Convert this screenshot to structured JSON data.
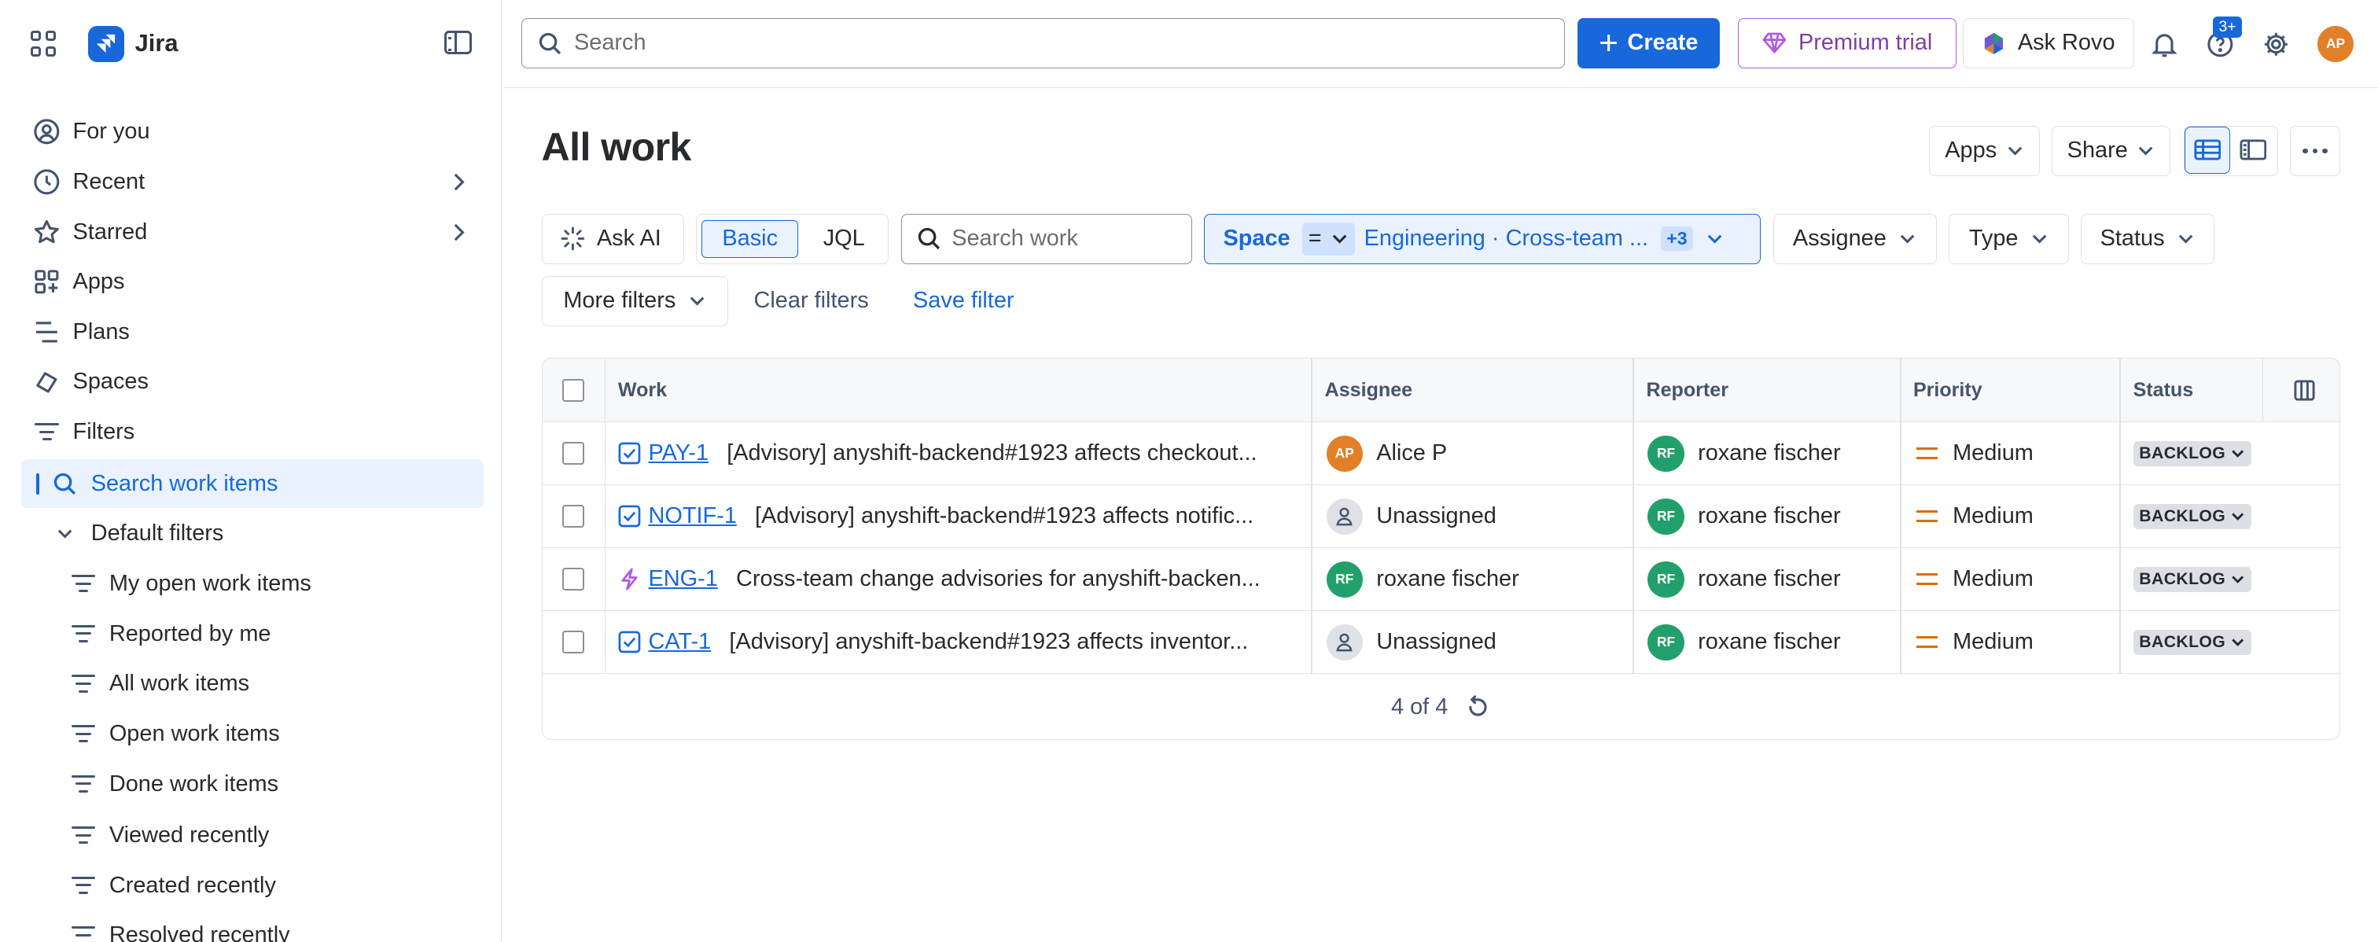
{
  "app": {
    "name": "Jira"
  },
  "sidebar": {
    "nav": [
      {
        "label": "For you",
        "icon": "user-circle-icon"
      },
      {
        "label": "Recent",
        "icon": "clock-icon",
        "has_chevron": true
      },
      {
        "label": "Starred",
        "icon": "star-icon",
        "has_chevron": true
      },
      {
        "label": "Apps",
        "icon": "apps-icon"
      },
      {
        "label": "Plans",
        "icon": "plans-icon"
      },
      {
        "label": "Spaces",
        "icon": "spaces-icon"
      },
      {
        "label": "Filters",
        "icon": "filter-icon"
      }
    ],
    "search_work_items": "Search work items",
    "default_filters": "Default filters",
    "filters": [
      "My open work items",
      "Reported by me",
      "All work items",
      "Open work items",
      "Done work items",
      "Viewed recently",
      "Created recently",
      "Resolved recently"
    ]
  },
  "topbar": {
    "search_placeholder": "Search",
    "create_label": "Create",
    "premium_label": "Premium trial",
    "rovo_label": "Ask Rovo",
    "help_badge": "3+",
    "avatar_initials": "AP"
  },
  "main": {
    "title": "All work",
    "apps_label": "Apps",
    "share_label": "Share",
    "ask_ai_label": "Ask AI",
    "basic_label": "Basic",
    "jql_label": "JQL",
    "work_search_placeholder": "Search work",
    "space_filter": {
      "label": "Space",
      "operator": "=",
      "value": "Engineering · Cross-team ...",
      "extra_count": "+3"
    },
    "assignee_label": "Assignee",
    "type_label": "Type",
    "status_label": "Status",
    "more_filters_label": "More filters",
    "clear_filters_label": "Clear filters",
    "save_filter_label": "Save filter"
  },
  "table": {
    "columns": [
      "Work",
      "Assignee",
      "Reporter",
      "Priority",
      "Status"
    ],
    "rows": [
      {
        "type_icon": "task-icon",
        "key": "PAY-1",
        "summary": "[Advisory] anyshift-backend#1923 affects checkout...",
        "assignee": "Alice P",
        "assignee_initials": "AP",
        "assignee_kind": "ap",
        "reporter": "roxane fischer",
        "reporter_initials": "RF",
        "priority": "Medium",
        "status": "BACKLOG"
      },
      {
        "type_icon": "task-icon",
        "key": "NOTIF-1",
        "summary": "[Advisory] anyshift-backend#1923 affects notific...",
        "assignee": "Unassigned",
        "assignee_initials": "",
        "assignee_kind": "un",
        "reporter": "roxane fischer",
        "reporter_initials": "RF",
        "priority": "Medium",
        "status": "BACKLOG"
      },
      {
        "type_icon": "epic-icon",
        "key": "ENG-1",
        "summary": "Cross-team change advisories for anyshift-backen...",
        "assignee": "roxane fischer",
        "assignee_initials": "RF",
        "assignee_kind": "rf",
        "reporter": "roxane fischer",
        "reporter_initials": "RF",
        "priority": "Medium",
        "status": "BACKLOG"
      },
      {
        "type_icon": "task-icon",
        "key": "CAT-1",
        "summary": "[Advisory] anyshift-backend#1923 affects inventor...",
        "assignee": "Unassigned",
        "assignee_initials": "",
        "assignee_kind": "un",
        "reporter": "roxane fischer",
        "reporter_initials": "RF",
        "priority": "Medium",
        "status": "BACKLOG"
      }
    ],
    "footer_count": "4 of 4"
  },
  "colors": {
    "brand": "#1868db",
    "premium": "#af59e1",
    "priority_medium": "#e06c00",
    "avatar_ap": "#e2802a",
    "avatar_rf": "#22a06b"
  }
}
